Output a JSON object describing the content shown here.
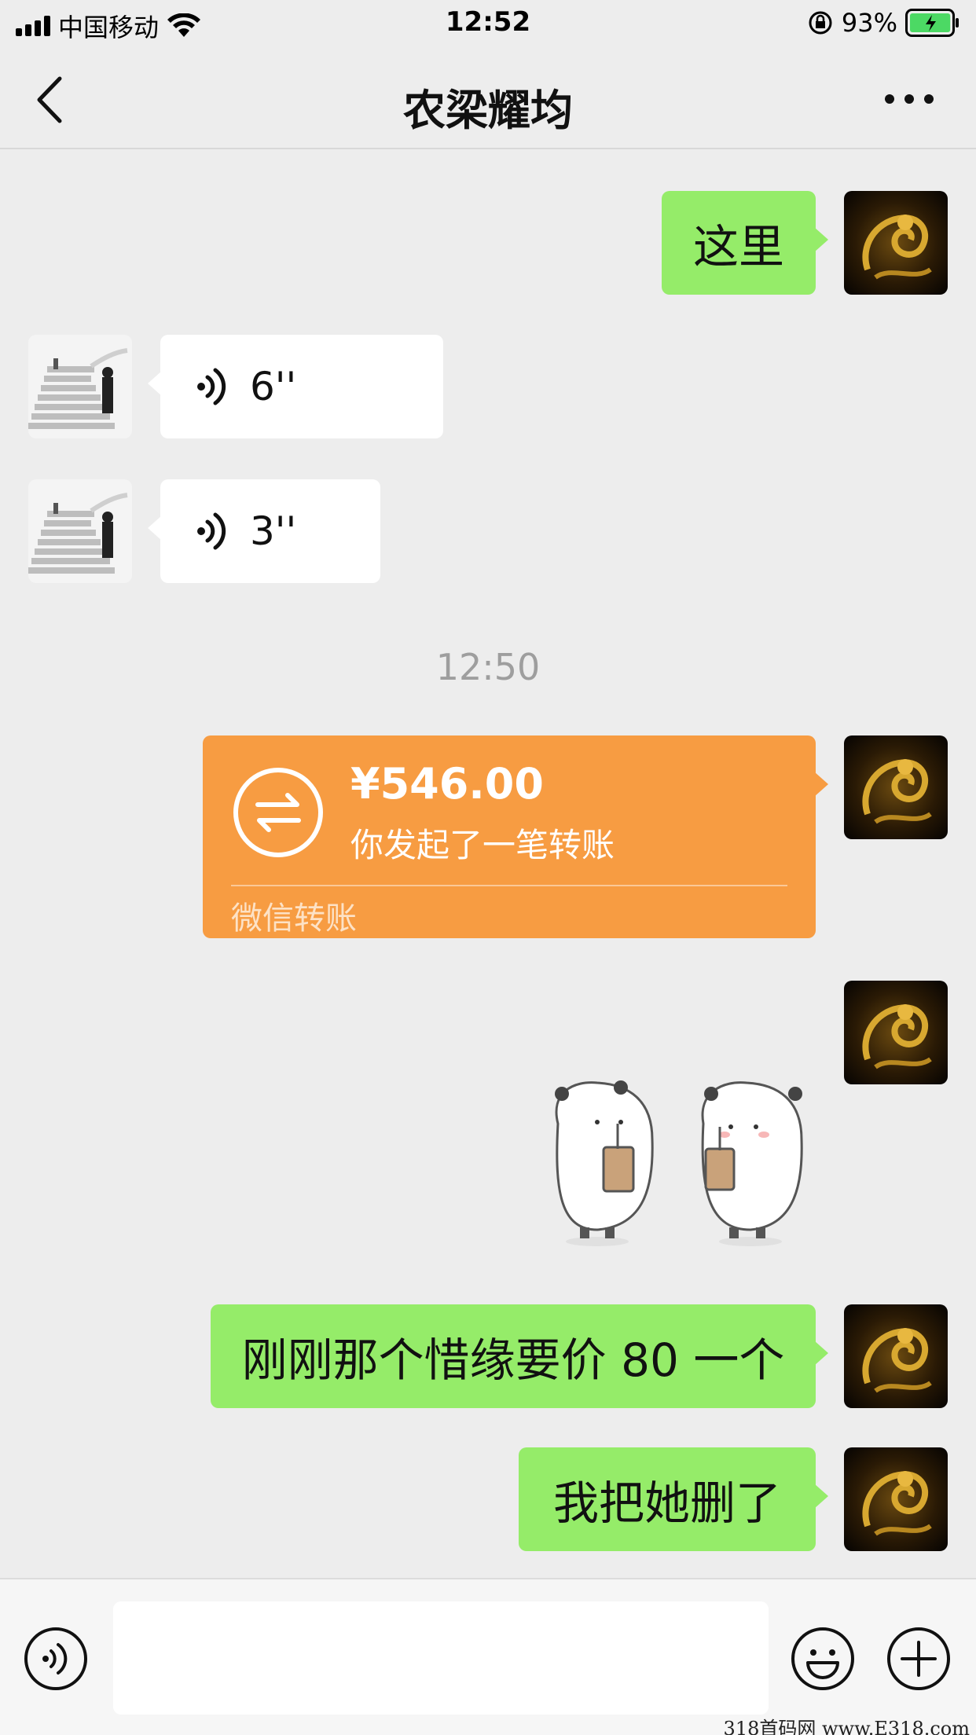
{
  "status_bar": {
    "carrier": "中国移动",
    "time": "12:52",
    "battery_percent": "93%",
    "battery_level": 0.93
  },
  "nav": {
    "title": "农梁耀均",
    "back_icon": "chevron-left-icon",
    "more_icon": "ellipsis-icon"
  },
  "messages": [
    {
      "side": "right",
      "type": "text",
      "text": "这里"
    },
    {
      "side": "left",
      "type": "voice",
      "duration": "6''"
    },
    {
      "side": "left",
      "type": "voice",
      "duration": "3''"
    },
    {
      "type": "timestamp",
      "text": "12:50"
    },
    {
      "side": "right",
      "type": "transfer",
      "amount": "¥546.00",
      "description": "你发起了一笔转账",
      "footer": "微信转账"
    },
    {
      "side": "right",
      "type": "sticker",
      "icon": "panda-bubble-tea-sticker"
    },
    {
      "side": "right",
      "type": "text",
      "text": "刚刚那个惜缘要价 80 一个"
    },
    {
      "side": "right",
      "type": "text",
      "text": "我把她删了"
    }
  ],
  "input_bar": {
    "placeholder": "",
    "value": "",
    "voice_icon": "voice-toggle-icon",
    "emoji_icon": "emoji-icon",
    "add_icon": "plus-icon"
  },
  "colors": {
    "background": "#ededed",
    "outgoing_bubble": "#95ec69",
    "incoming_bubble": "#ffffff",
    "transfer_card": "#f79c42",
    "timestamp": "#9e9e9e"
  },
  "watermark": "318首码网  www.E318.com"
}
